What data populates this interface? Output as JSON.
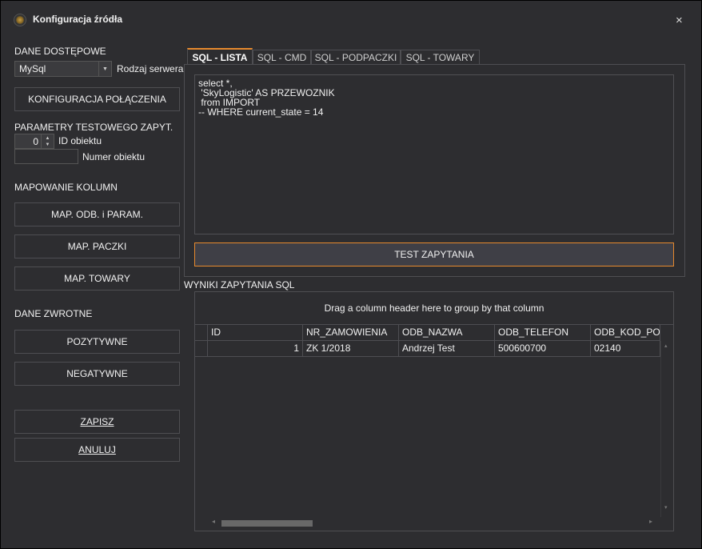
{
  "window": {
    "title": "Konfiguracja źródła",
    "close_glyph": "×"
  },
  "left": {
    "access_heading": "DANE DOSTĘPOWE",
    "server_type": {
      "value": "MySql",
      "label": "Rodzaj serwera"
    },
    "connection_button": "KONFIGURACJA POŁĄCZENIA",
    "test_params_heading": "PARAMETRY TESTOWEGO ZAPYT.",
    "object_id": {
      "value": "0",
      "label": "ID obiektu"
    },
    "object_number": {
      "value": "",
      "label": "Numer obiektu"
    },
    "mapping_heading": "MAPOWANIE KOLUMN",
    "map_buttons": [
      "MAP. ODB. i PARAM.",
      "MAP. PACZKI",
      "MAP. TOWARY"
    ],
    "return_heading": "DANE ZWROTNE",
    "positive_button": "POZYTYWNE",
    "negative_button": "NEGATYWNE",
    "save_button": "ZAPISZ",
    "cancel_button": "ANULUJ"
  },
  "tabs": [
    "SQL - LISTA",
    "SQL - CMD",
    "SQL - PODPACZKI",
    "SQL - TOWARY"
  ],
  "active_tab": 0,
  "sql_text": "select *,\n 'SkyLogistic' AS PRZEWOZNIK\n from IMPORT\n-- WHERE current_state = 14",
  "test_button": "TEST ZAPYTANIA",
  "results": {
    "heading": "WYNIKI ZAPYTANIA SQL",
    "group_hint": "Drag a column header here to group by that column",
    "columns": [
      "ID",
      "NR_ZAMOWIENIA",
      "ODB_NAZWA",
      "ODB_TELEFON",
      "ODB_KOD_POC"
    ],
    "rows": [
      [
        "1",
        "ZK 1/2018",
        "Andrzej Test",
        "500600700",
        "02140"
      ]
    ]
  },
  "colors": {
    "accent": "#e68a2e",
    "background": "#2d2d30",
    "border": "#4e4e52"
  }
}
